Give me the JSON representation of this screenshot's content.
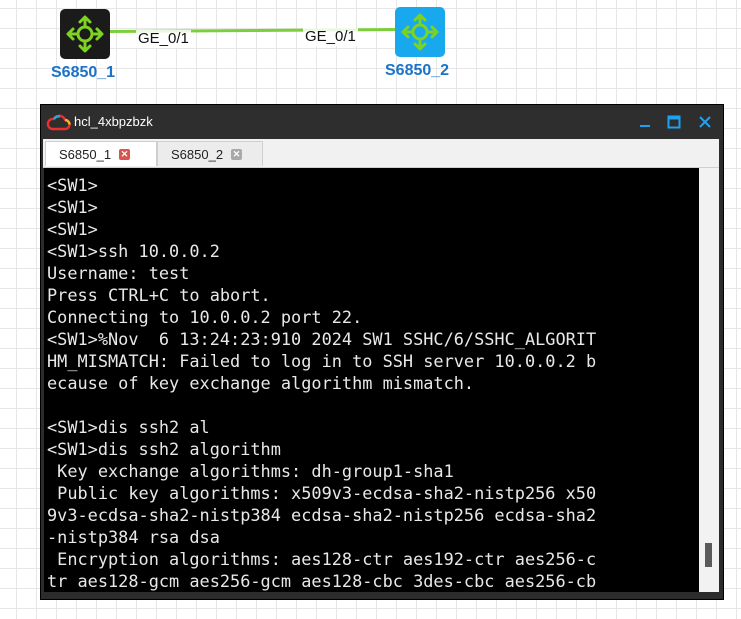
{
  "topology": {
    "link_color": "#7ccf3a",
    "ports": {
      "left": "GE_0/1",
      "right": "GE_0/1"
    },
    "devices": [
      {
        "name": "S6850_1",
        "icon": "switch-icon",
        "color": "#1b1b1b"
      },
      {
        "name": "S6850_2",
        "icon": "switch-icon",
        "color": "#17a8ee"
      }
    ]
  },
  "window": {
    "title": "hcl_4xbpzbzk",
    "icon": "cloud-icon",
    "buttons": {
      "minimize": "minimize-icon",
      "maximize": "maximize-icon",
      "close": "close-icon"
    }
  },
  "tabs": [
    {
      "label": "S6850_1",
      "active": true,
      "close_icon": "close-icon"
    },
    {
      "label": "S6850_2",
      "active": false,
      "close_icon": "close-icon"
    }
  ],
  "terminal": {
    "lines": [
      "<SW1>",
      "<SW1>",
      "<SW1>",
      "<SW1>ssh 10.0.0.2",
      "Username: test",
      "Press CTRL+C to abort.",
      "Connecting to 10.0.0.2 port 22.",
      "<SW1>%Nov  6 13:24:23:910 2024 SW1 SSHC/6/SSHC_ALGORIT",
      "HM_MISMATCH: Failed to log in to SSH server 10.0.0.2 b",
      "ecause of key exchange algorithm mismatch.",
      "",
      "<SW1>dis ssh2 al",
      "<SW1>dis ssh2 algorithm",
      " Key exchange algorithms: dh-group1-sha1",
      " Public key algorithms: x509v3-ecdsa-sha2-nistp256 x50",
      "9v3-ecdsa-sha2-nistp384 ecdsa-sha2-nistp256 ecdsa-sha2",
      "-nistp384 rsa dsa",
      " Encryption algorithms: aes128-ctr aes192-ctr aes256-c",
      "tr aes128-gcm aes256-gcm aes128-cbc 3des-cbc aes256-cb"
    ]
  }
}
